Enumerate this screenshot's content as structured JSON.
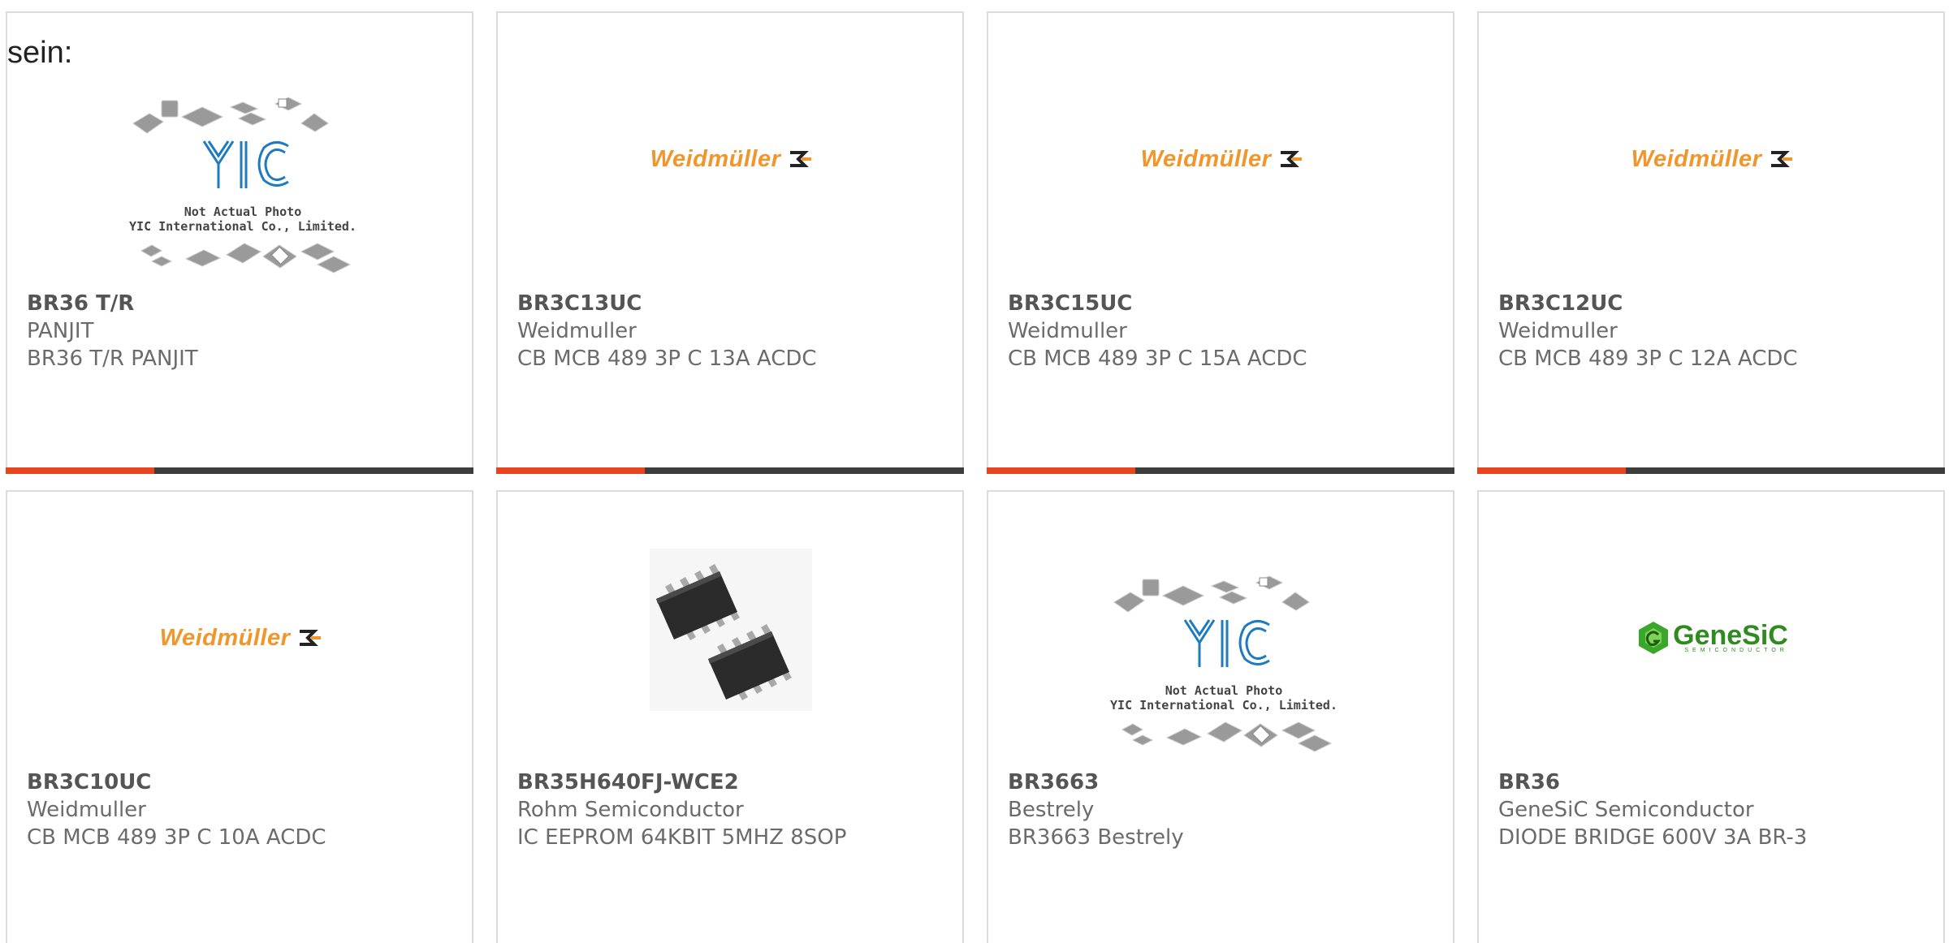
{
  "header": {
    "sein_text": "sein:"
  },
  "colors": {
    "accent": "#e8441d",
    "bar": "#3d3d3d",
    "border": "#dcdcdc",
    "weidmuller": "#f0962a",
    "genesic": "#2f8a1f"
  },
  "placeholder": {
    "brand": "YIC",
    "line1": "Not Actual Photo",
    "line2": "YIC International Co., Limited."
  },
  "brands": {
    "weidmuller": "Weidmüller",
    "genesic": "GeneSiC",
    "genesic_sub": "SEMICONDUCTOR"
  },
  "products": [
    {
      "part": "BR36 T/R",
      "manufacturer": "PANJIT",
      "description": "BR36 T/R PANJIT",
      "image": "not-actual-photo"
    },
    {
      "part": "BR3C13UC",
      "manufacturer": "Weidmuller",
      "description": "CB MCB 489 3P C 13A ACDC",
      "image": "weidmuller-logo"
    },
    {
      "part": "BR3C15UC",
      "manufacturer": "Weidmuller",
      "description": "CB MCB 489 3P C 15A ACDC",
      "image": "weidmuller-logo"
    },
    {
      "part": "BR3C12UC",
      "manufacturer": "Weidmuller",
      "description": "CB MCB 489 3P C 12A ACDC",
      "image": "weidmuller-logo"
    },
    {
      "part": "BR3C10UC",
      "manufacturer": "Weidmuller",
      "description": "CB MCB 489 3P C 10A ACDC",
      "image": "weidmuller-logo"
    },
    {
      "part": "BR35H640FJ-WCE2",
      "manufacturer": "Rohm Semiconductor",
      "description": "IC EEPROM 64KBIT 5MHZ 8SOP",
      "image": "sop8-chip-photo"
    },
    {
      "part": "BR3663",
      "manufacturer": "Bestrely",
      "description": "BR3663 Bestrely",
      "image": "not-actual-photo"
    },
    {
      "part": "BR36",
      "manufacturer": "GeneSiC Semiconductor",
      "description": "DIODE BRIDGE 600V 3A BR-3",
      "image": "genesic-logo"
    }
  ]
}
